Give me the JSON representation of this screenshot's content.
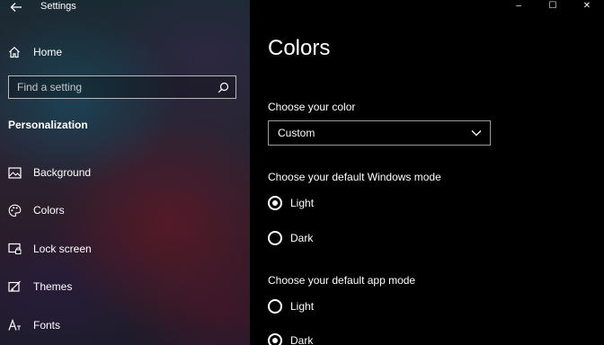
{
  "app": {
    "title": "Settings",
    "back_icon": "back-arrow-icon"
  },
  "window_controls": {
    "minimize": "–",
    "maximize": "☐",
    "close": "✕"
  },
  "sidebar": {
    "home_label": "Home",
    "search": {
      "placeholder": "Find a setting",
      "value": ""
    },
    "section_title": "Personalization",
    "items": [
      {
        "label": "Background",
        "icon": "picture-icon"
      },
      {
        "label": "Colors",
        "icon": "palette-icon"
      },
      {
        "label": "Lock screen",
        "icon": "lock-screen-icon"
      },
      {
        "label": "Themes",
        "icon": "themes-icon"
      },
      {
        "label": "Fonts",
        "icon": "fonts-icon"
      }
    ]
  },
  "main": {
    "title": "Colors",
    "choose_color": {
      "label": "Choose your color",
      "selected": "Custom"
    },
    "windows_mode": {
      "label": "Choose your default Windows mode",
      "options": [
        {
          "label": "Light",
          "checked": true
        },
        {
          "label": "Dark",
          "checked": false
        }
      ]
    },
    "app_mode": {
      "label": "Choose your default app mode",
      "options": [
        {
          "label": "Light",
          "checked": false
        },
        {
          "label": "Dark",
          "checked": true
        }
      ]
    }
  },
  "colors": {
    "main_background": "#000000",
    "text": "#ffffff",
    "control_border": "#9a9a9a"
  }
}
